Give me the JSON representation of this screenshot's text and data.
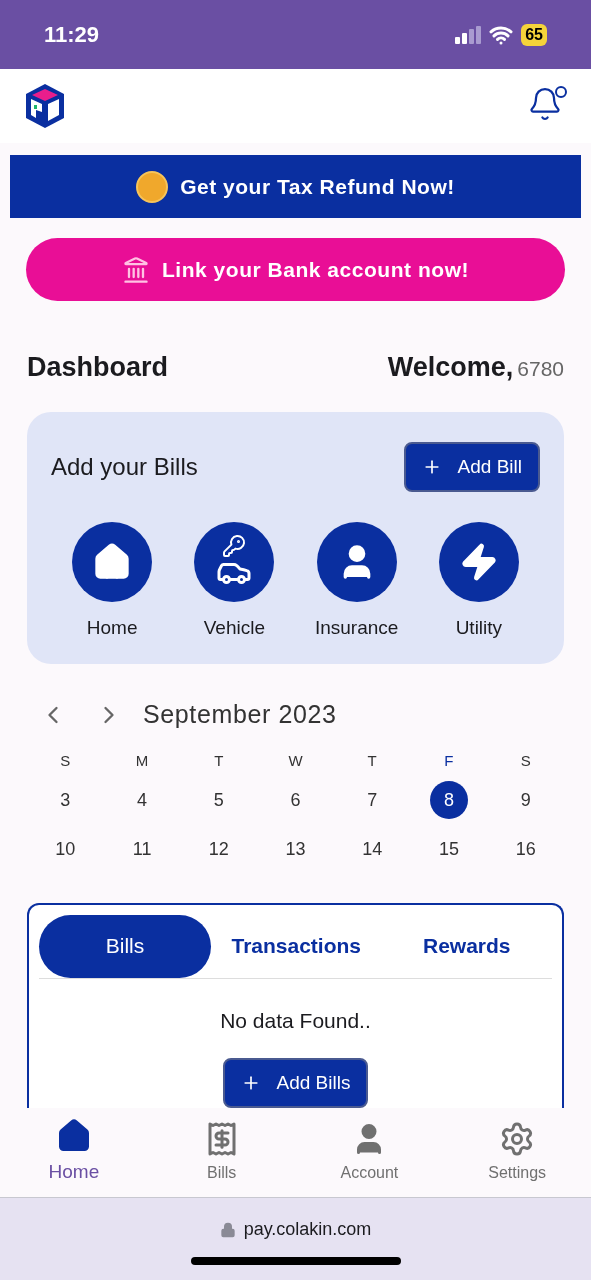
{
  "status_bar": {
    "time": "11:29",
    "battery": "65"
  },
  "promo_banner": {
    "text": "Get your Tax Refund Now!"
  },
  "link_bank_button": {
    "text": "Link your Bank account now!"
  },
  "dashboard": {
    "title": "Dashboard",
    "welcome": "Welcome,",
    "user_id": "6780"
  },
  "bills_card": {
    "title": "Add your Bills",
    "add_button": "Add Bill",
    "categories": [
      {
        "label": "Home"
      },
      {
        "label": "Vehicle"
      },
      {
        "label": "Insurance"
      },
      {
        "label": "Utility"
      }
    ]
  },
  "calendar": {
    "month": "September 2023",
    "weekdays": [
      {
        "label": "S",
        "selected": false
      },
      {
        "label": "M",
        "selected": false
      },
      {
        "label": "T",
        "selected": false
      },
      {
        "label": "W",
        "selected": false
      },
      {
        "label": "T",
        "selected": false
      },
      {
        "label": "F",
        "selected": true
      },
      {
        "label": "S",
        "selected": false
      }
    ],
    "days": [
      {
        "label": "3",
        "selected": false
      },
      {
        "label": "4",
        "selected": false
      },
      {
        "label": "5",
        "selected": false
      },
      {
        "label": "6",
        "selected": false
      },
      {
        "label": "7",
        "selected": false
      },
      {
        "label": "8",
        "selected": true
      },
      {
        "label": "9",
        "selected": false
      },
      {
        "label": "10",
        "selected": false
      },
      {
        "label": "11",
        "selected": false
      },
      {
        "label": "12",
        "selected": false
      },
      {
        "label": "13",
        "selected": false
      },
      {
        "label": "14",
        "selected": false
      },
      {
        "label": "15",
        "selected": false
      },
      {
        "label": "16",
        "selected": false
      }
    ]
  },
  "tabs": [
    {
      "label": "Bills",
      "selected": true
    },
    {
      "label": "Transactions",
      "selected": false
    },
    {
      "label": "Rewards",
      "selected": false
    }
  ],
  "empty_state": {
    "message": "No data Found..",
    "button": "Add Bills"
  },
  "bottom_nav": [
    {
      "label": "Home",
      "selected": true
    },
    {
      "label": "Bills",
      "selected": false
    },
    {
      "label": "Account",
      "selected": false
    },
    {
      "label": "Settings",
      "selected": false
    }
  ],
  "browser": {
    "url": "pay.colakin.com"
  }
}
